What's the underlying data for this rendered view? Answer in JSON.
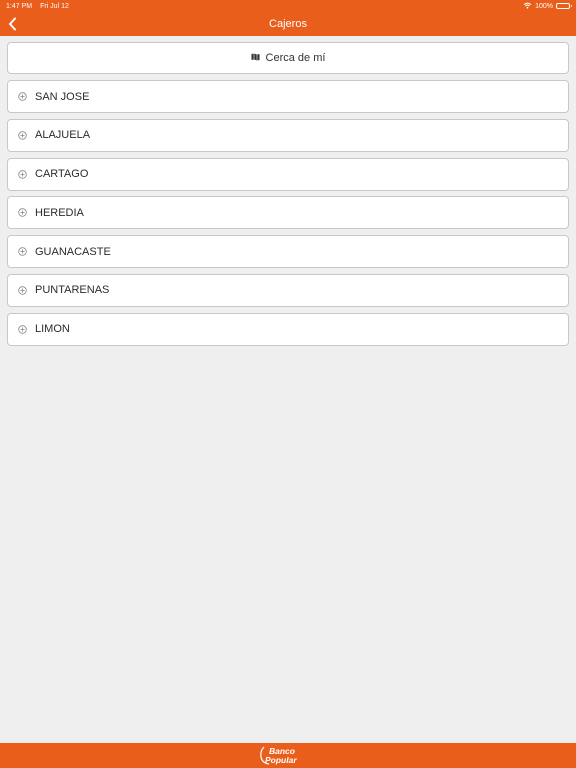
{
  "status": {
    "time": "1:47 PM",
    "date": "Fri Jul 12",
    "battery": "100%"
  },
  "nav": {
    "title": "Cajeros"
  },
  "nearby": {
    "label": "Cerca de mí"
  },
  "regions": [
    "SAN JOSE",
    "ALAJUELA",
    "CARTAGO",
    "HEREDIA",
    "GUANACASTE",
    "PUNTARENAS",
    "LIMON"
  ],
  "footer": {
    "logo_line1": "Banco",
    "logo_line2": "Popular"
  },
  "colors": {
    "brand": "#ea5e1c",
    "background": "#efefef",
    "card": "#ffffff",
    "border": "#c8c8c8"
  }
}
